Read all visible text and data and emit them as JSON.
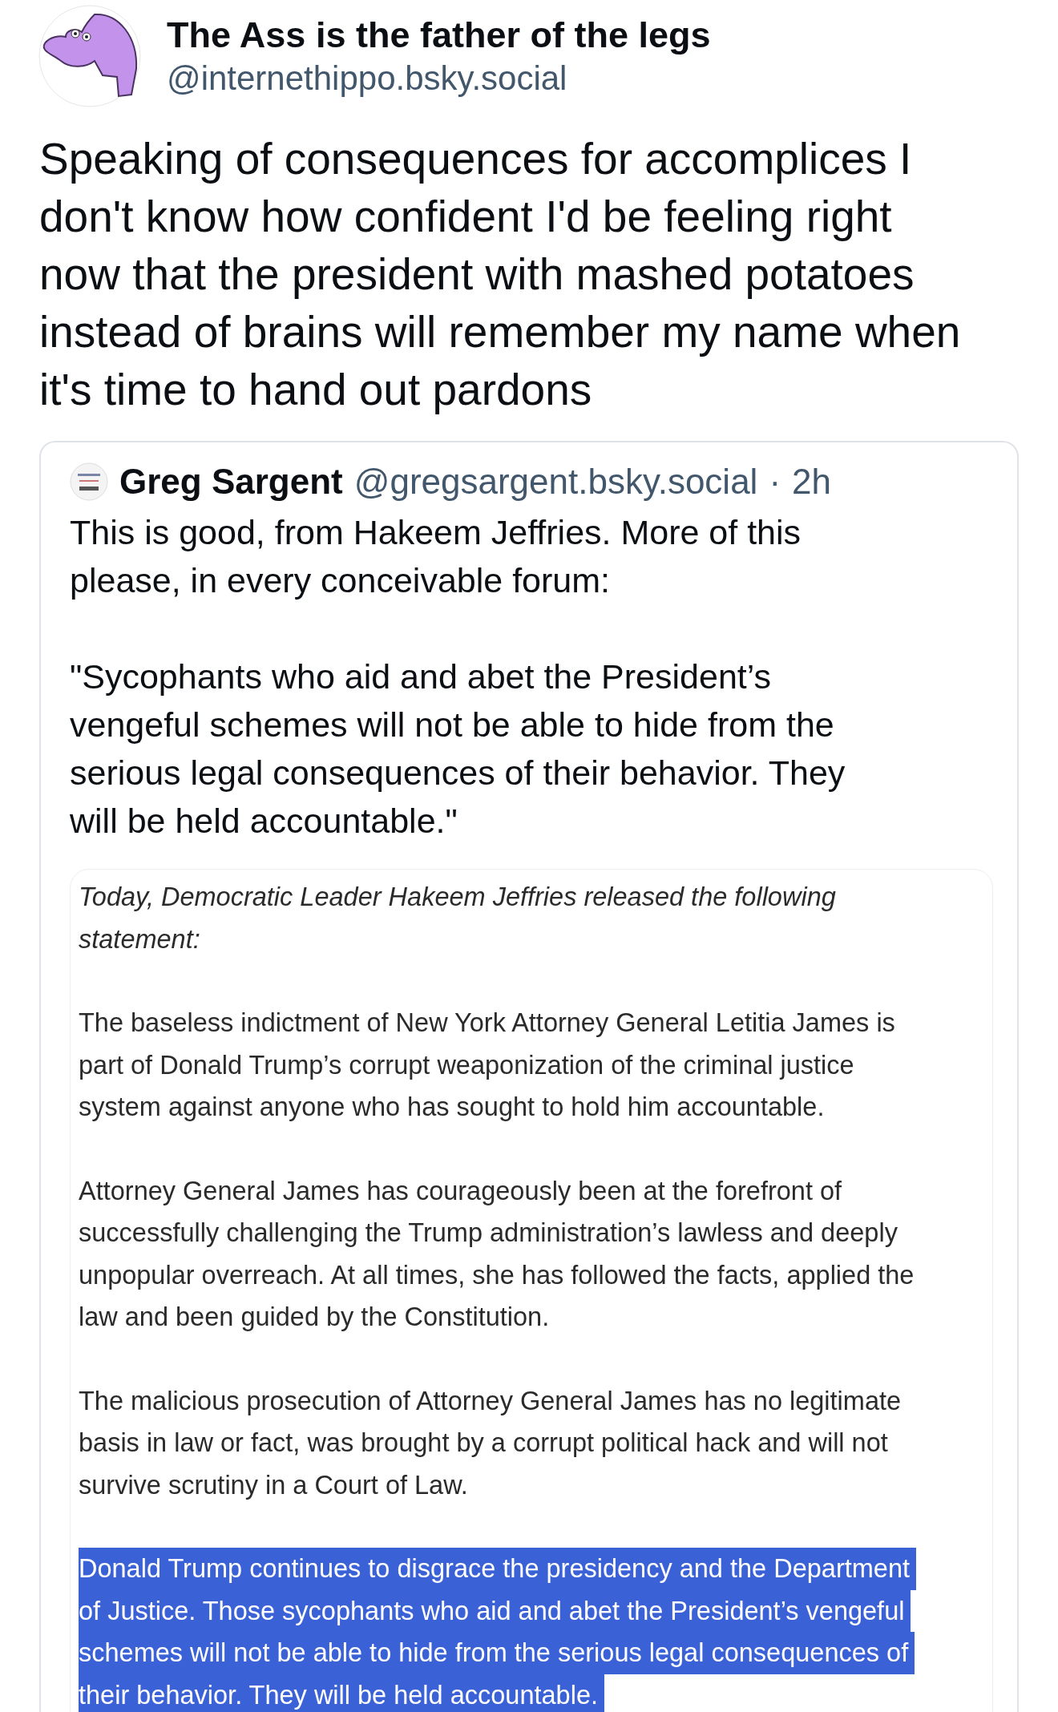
{
  "author": {
    "display_name": "The Ass is the father of the legs",
    "handle": "@internethippo.bsky.social"
  },
  "post_text_lines": [
    "Speaking of consequences for accomplices I",
    "don't know how confident I'd be feeling right",
    "now that the president with mashed potatoes",
    "instead of brains will remember my name when",
    "it's time to hand out pardons"
  ],
  "quoted_post": {
    "author_name": "Greg Sargent",
    "author_handle": "@gregsargent.bsky.social",
    "separator": "·",
    "time": "2h",
    "paragraphs": [
      {
        "lines": [
          "This is good, from Hakeem Jeffries. More of this",
          "please, in every conceivable forum:"
        ]
      },
      {
        "lines": [
          "\"Sycophants who aid and abet the President’s",
          "vengeful schemes will not be able to hide from the",
          "serious legal consequences of their behavior. They",
          "will be held accountable.\""
        ]
      }
    ],
    "statement_image": {
      "paragraphs": [
        {
          "italic": true,
          "highlighted": false,
          "lines": [
            "Today, Democratic Leader Hakeem Jeffries released the following",
            "statement:"
          ]
        },
        {
          "italic": false,
          "highlighted": false,
          "lines": [
            "The baseless indictment of New York Attorney General Letitia James is",
            "part of Donald Trump’s corrupt weaponization of the criminal justice",
            "system against anyone who has sought to hold him accountable."
          ]
        },
        {
          "italic": false,
          "highlighted": false,
          "lines": [
            "Attorney General James has courageously been at the forefront of",
            "successfully challenging the Trump administration’s lawless and deeply",
            "unpopular overreach. At all times, she has followed the facts, applied the",
            "law and been guided by the Constitution."
          ]
        },
        {
          "italic": false,
          "highlighted": false,
          "lines": [
            "The malicious prosecution of Attorney General James has no legitimate",
            "basis in law or fact, was brought by a corrupt political hack and will not",
            "survive scrutiny in a Court of Law."
          ]
        },
        {
          "italic": false,
          "highlighted": true,
          "lines": [
            "Donald Trump continues to disgrace the presidency and the Department",
            "of Justice. Those sycophants who aid and abet the President’s vengeful",
            "schemes will not be able to hide from the serious legal consequences of",
            "their behavior. They will be held accountable."
          ]
        }
      ]
    }
  }
}
